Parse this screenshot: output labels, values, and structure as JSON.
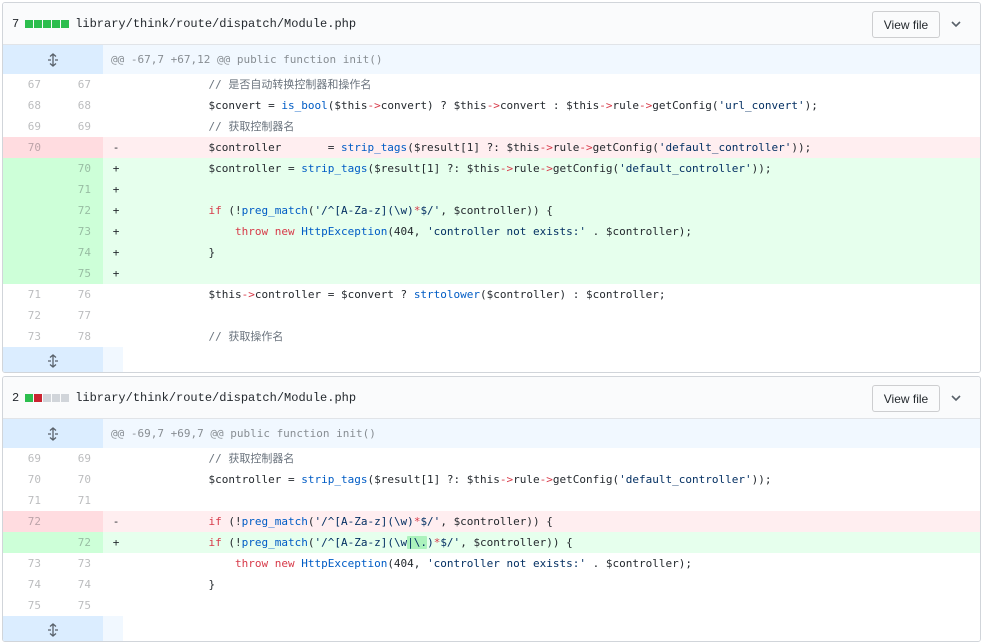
{
  "files": [
    {
      "changes_count": "7",
      "diffstat": [
        "added",
        "added",
        "added",
        "added",
        "added"
      ],
      "path": "library/think/route/dispatch/Module.php",
      "view_file_label": "View file",
      "hunk_header": "@@ -67,7 +67,12 @@ public function init()",
      "lines": [
        {
          "type": "ctx",
          "old": "67",
          "new": "67",
          "marker": "",
          "code": "            // 是否自动转换控制器和操作名"
        },
        {
          "type": "ctx",
          "old": "68",
          "new": "68",
          "marker": "",
          "code": "            $convert = is_bool($this->convert) ? $this->convert : $this->rule->getConfig('url_convert');"
        },
        {
          "type": "ctx",
          "old": "69",
          "new": "69",
          "marker": "",
          "code": "            // 获取控制器名"
        },
        {
          "type": "del",
          "old": "70",
          "new": "",
          "marker": "-",
          "code": "            $controller       = strip_tags($result[1] ?: $this->rule->getConfig('default_controller'));"
        },
        {
          "type": "add",
          "old": "",
          "new": "70",
          "marker": "+",
          "code": "            $controller = strip_tags($result[1] ?: $this->rule->getConfig('default_controller'));"
        },
        {
          "type": "add",
          "old": "",
          "new": "71",
          "marker": "+",
          "code": ""
        },
        {
          "type": "add",
          "old": "",
          "new": "72",
          "marker": "+",
          "code": "            if (!preg_match('/^[A-Za-z](\\w)*$/', $controller)) {"
        },
        {
          "type": "add",
          "old": "",
          "new": "73",
          "marker": "+",
          "code": "                throw new HttpException(404, 'controller not exists:' . $controller);"
        },
        {
          "type": "add",
          "old": "",
          "new": "74",
          "marker": "+",
          "code": "            }"
        },
        {
          "type": "add",
          "old": "",
          "new": "75",
          "marker": "+",
          "code": ""
        },
        {
          "type": "ctx",
          "old": "71",
          "new": "76",
          "marker": "",
          "code": "            $this->controller = $convert ? strtolower($controller) : $controller;"
        },
        {
          "type": "ctx",
          "old": "72",
          "new": "77",
          "marker": "",
          "code": ""
        },
        {
          "type": "ctx",
          "old": "73",
          "new": "78",
          "marker": "",
          "code": "            // 获取操作名"
        }
      ]
    },
    {
      "changes_count": "2",
      "diffstat": [
        "added",
        "deleted",
        "neutral",
        "neutral",
        "neutral"
      ],
      "path": "library/think/route/dispatch/Module.php",
      "view_file_label": "View file",
      "hunk_header": "@@ -69,7 +69,7 @@ public function init()",
      "lines": [
        {
          "type": "ctx",
          "old": "69",
          "new": "69",
          "marker": "",
          "code": "            // 获取控制器名"
        },
        {
          "type": "ctx",
          "old": "70",
          "new": "70",
          "marker": "",
          "code": "            $controller = strip_tags($result[1] ?: $this->rule->getConfig('default_controller'));"
        },
        {
          "type": "ctx",
          "old": "71",
          "new": "71",
          "marker": "",
          "code": ""
        },
        {
          "type": "del",
          "old": "72",
          "new": "",
          "marker": "-",
          "code": "            if (!preg_match('/^[A-Za-z](\\w)*$/', $controller)) {"
        },
        {
          "type": "add",
          "old": "",
          "new": "72",
          "marker": "+",
          "code": "            if (!preg_match('/^[A-Za-z](\\w|\\.)*$/', $controller)) {"
        },
        {
          "type": "ctx",
          "old": "73",
          "new": "73",
          "marker": "",
          "code": "                throw new HttpException(404, 'controller not exists:' . $controller);"
        },
        {
          "type": "ctx",
          "old": "74",
          "new": "74",
          "marker": "",
          "code": "            }"
        },
        {
          "type": "ctx",
          "old": "75",
          "new": "75",
          "marker": "",
          "code": ""
        }
      ]
    }
  ],
  "icons": {
    "expand": "unfold-icon",
    "collapse": "chevron-down-icon"
  },
  "colors": {
    "added": "#2cbe4e",
    "deleted": "#cb2431",
    "neutral": "#d1d5da",
    "add_bg": "#e6ffed",
    "del_bg": "#ffeef0",
    "hunk_bg": "#f1f8ff"
  }
}
